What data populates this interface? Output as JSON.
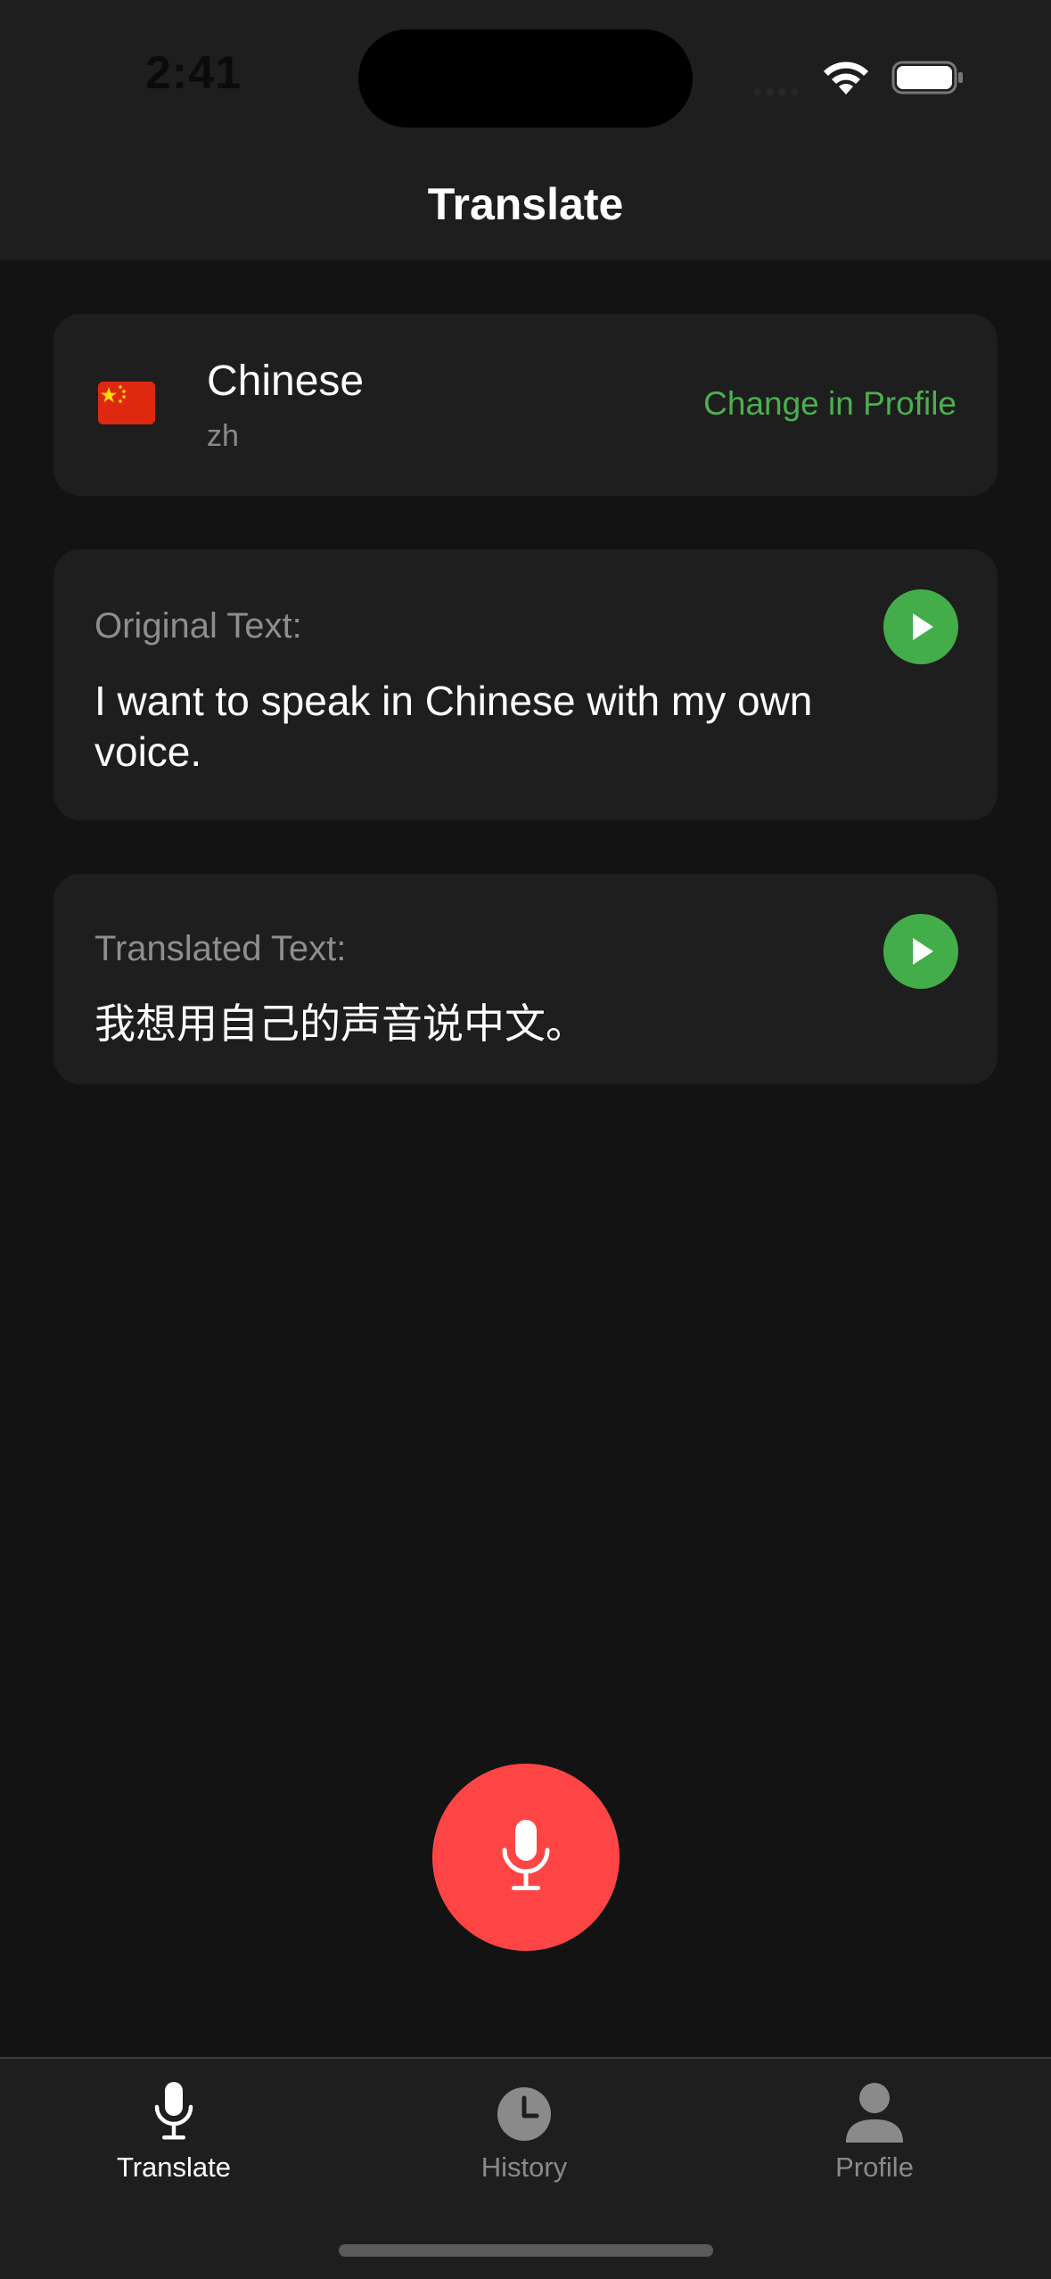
{
  "status_bar": {
    "time": "2:41"
  },
  "header": {
    "title": "Translate"
  },
  "language": {
    "flag_icon": "china-flag-icon",
    "name": "Chinese",
    "code": "zh",
    "change_label": "Change in Profile"
  },
  "original": {
    "label": "Original Text:",
    "text": "I want to speak in Chinese with my own voice."
  },
  "translated": {
    "label": "Translated Text:",
    "text": "我想用自己的声音说中文。"
  },
  "mic": {
    "icon": "microphone-icon"
  },
  "tabs": [
    {
      "label": "Translate",
      "icon": "microphone-icon",
      "active": true
    },
    {
      "label": "History",
      "icon": "clock-icon",
      "active": false
    },
    {
      "label": "Profile",
      "icon": "person-icon",
      "active": false
    }
  ],
  "colors": {
    "accent": "#4caf50",
    "record": "#fe4545",
    "background": "#131313",
    "card": "#1e1e1e"
  }
}
